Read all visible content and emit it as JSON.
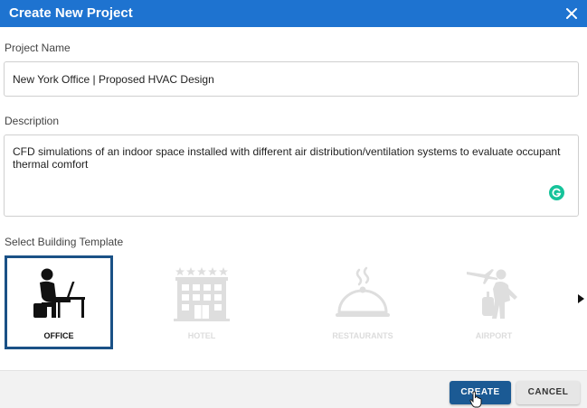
{
  "dialog": {
    "title": "Create New Project"
  },
  "form": {
    "project_name_label": "Project Name",
    "project_name_value": "New York Office | Proposed HVAC Design",
    "description_label": "Description",
    "description_value": "CFD simulations of an indoor space installed with different air distribution/ventilation systems to evaluate occupant thermal comfort",
    "template_label": "Select Building Template"
  },
  "templates": [
    {
      "label": "OFFICE",
      "icon": "office-worker-icon",
      "selected": true
    },
    {
      "label": "HOTEL",
      "icon": "hotel-building-icon",
      "selected": false
    },
    {
      "label": "RESTAURANTS",
      "icon": "cloche-icon",
      "selected": false
    },
    {
      "label": "AIRPORT",
      "icon": "traveler-icon",
      "selected": false
    }
  ],
  "actions": {
    "create_label": "CREATE",
    "cancel_label": "CANCEL"
  },
  "colors": {
    "header": "#1e73d0",
    "selected_border": "#1a5186",
    "primary_button": "#1b5a94",
    "grammarly": "#15c39a"
  }
}
